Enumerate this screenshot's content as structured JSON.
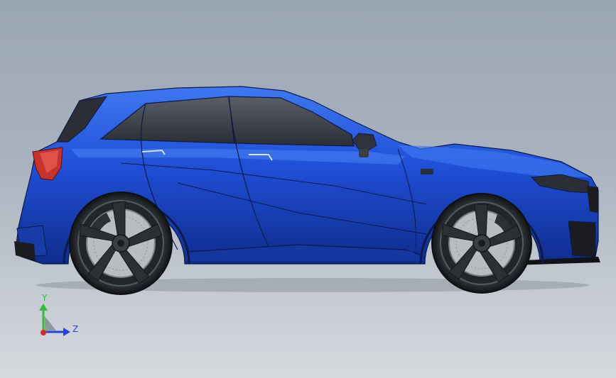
{
  "viewport": {
    "background_top": "#9aa5b3",
    "background_bottom": "#d5d9de"
  },
  "model": {
    "body_color": "#1f4fd6",
    "body_highlight": "#3f78f0",
    "body_shadow": "#0f2c8c",
    "glass_color": "#3c4048",
    "light_color": "#c8322d",
    "wheel_color": "#2c2f33",
    "disc_color": "#b9bcc0",
    "edge_color": "#0a1a4a"
  },
  "triad": {
    "y_label": "Y",
    "z_label": "Z",
    "y_color": "#2fbf3a",
    "z_color": "#2346d8",
    "x_color": "#d42a2a"
  }
}
